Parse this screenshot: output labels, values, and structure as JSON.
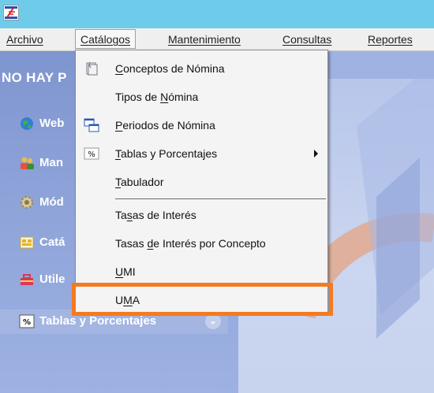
{
  "colors": {
    "titlebar": "#6ECCEA",
    "menubar": "#EFEFEF",
    "panel": "#8EA4DA",
    "dropdown": "#F4F4F4",
    "highlight": "#F47A20"
  },
  "menubar": {
    "items": [
      {
        "label": "Archivo"
      },
      {
        "label": "Catálogos"
      },
      {
        "label": "Mantenimiento"
      },
      {
        "label": "Consultas"
      },
      {
        "label": "Reportes"
      }
    ]
  },
  "left_panel": {
    "title": "NO HAY P",
    "items": [
      {
        "label": "Web",
        "icon": "globe-icon"
      },
      {
        "label": "Man",
        "icon": "users-icon"
      },
      {
        "label": "Mód",
        "icon": "gear-icon"
      },
      {
        "label": "Catá",
        "icon": "catalog-icon"
      },
      {
        "label": "Utile",
        "icon": "toolbox-icon"
      },
      {
        "label": "Tablas y Porcentajes",
        "icon": "percent-icon"
      }
    ]
  },
  "dropdown": {
    "items": [
      {
        "pre": "",
        "u": "C",
        "post": "onceptos de Nómina",
        "icon": "documents-icon"
      },
      {
        "pre": "Tipos de ",
        "u": "N",
        "post": "ómina",
        "icon": ""
      },
      {
        "pre": "",
        "u": "P",
        "post": "eriodos de Nómina",
        "icon": "windows-icon"
      },
      {
        "pre": "",
        "u": "T",
        "post": "ablas y Porcentajes",
        "icon": "percent-icon",
        "submenu": true
      },
      {
        "pre": "",
        "u": "T",
        "post": "abulador",
        "icon": ""
      },
      {
        "pre": "Ta",
        "u": "s",
        "post": "as de Interés",
        "icon": ""
      },
      {
        "pre": "Tasas ",
        "u": "d",
        "post": "e Interés por Concepto",
        "icon": ""
      },
      {
        "pre": "",
        "u": "U",
        "post": "MI",
        "icon": ""
      },
      {
        "pre": "U",
        "u": "M",
        "post": "A",
        "icon": ""
      }
    ]
  }
}
